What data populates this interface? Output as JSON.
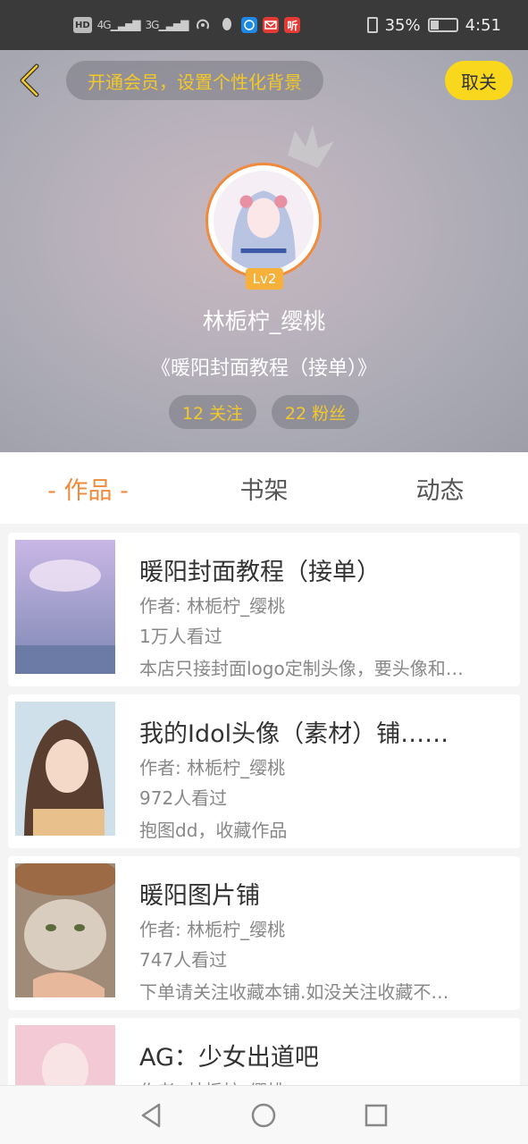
{
  "status_bar": {
    "left_indicators": [
      "HD",
      "4G",
      "3G"
    ],
    "app_icons": [
      "wifi-hotspot",
      "qq",
      "browser",
      "mail",
      "ting"
    ],
    "app3_label": "听",
    "battery_percent": "35%",
    "battery_level": 0.35,
    "time": "4:51"
  },
  "header": {
    "member_prompt": "开通会员，设置个性化背景",
    "cancel_label": "取关",
    "level": "Lv2",
    "username": "林栀柠_缨桃",
    "motto": "《暖阳封面教程（接单）》",
    "following": "12 关注",
    "fans": "22 粉丝"
  },
  "tabs": [
    {
      "label": "- 作品 -",
      "active": true
    },
    {
      "label": "书架",
      "active": false
    },
    {
      "label": "动态",
      "active": false
    }
  ],
  "works": [
    {
      "title": "暖阳封面教程（接单）",
      "author": "作者: 林栀柠_缨桃",
      "views": "1万人看过",
      "desc": "本店只接封面logo定制头像，要头像和…"
    },
    {
      "title": "我的Idol头像（素材）铺……",
      "author": "作者: 林栀柠_缨桃",
      "views": "972人看过",
      "desc": "抱图dd，收藏作品"
    },
    {
      "title": "暖阳图片铺",
      "author": "作者: 林栀柠_缨桃",
      "views": "747人看过",
      "desc": "下单请关注收藏本铺.如没关注收藏不…"
    },
    {
      "title": "AG：少女出道吧",
      "author": "作者: 林栀柠_缨桃",
      "views": "",
      "desc": ""
    }
  ],
  "colors": {
    "accent_orange": "#f08a3c",
    "accent_yellow": "#f9d71c",
    "pill_text": "#f3c92a"
  }
}
